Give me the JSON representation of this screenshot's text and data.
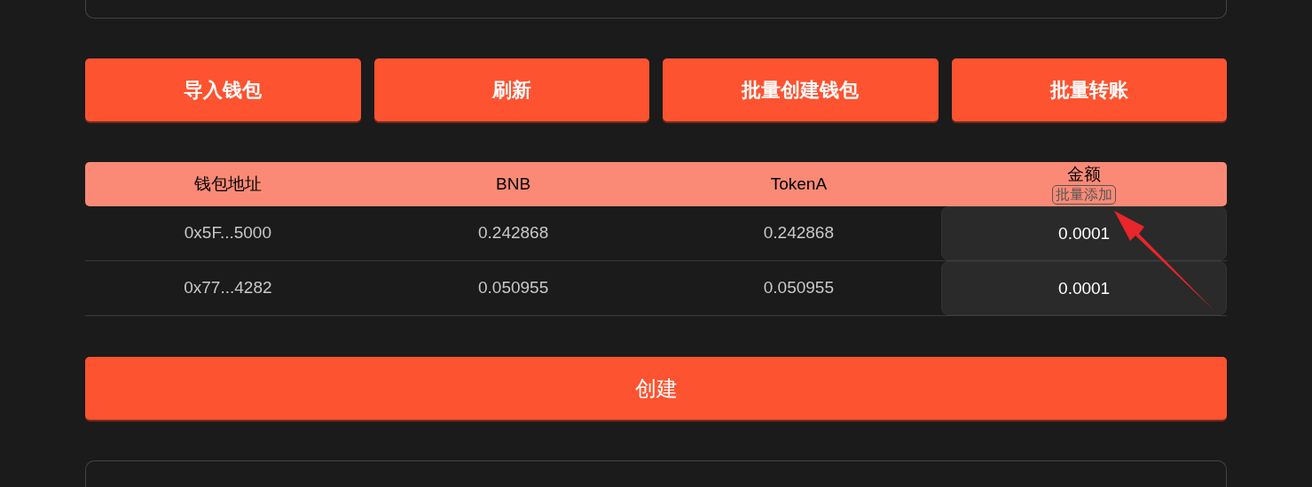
{
  "action_buttons": [
    {
      "label": "导入钱包"
    },
    {
      "label": "刷新"
    },
    {
      "label": "批量创建钱包"
    },
    {
      "label": "批量转账"
    }
  ],
  "table": {
    "columns": [
      {
        "label": "钱包地址"
      },
      {
        "label": "BNB"
      },
      {
        "label": "TokenA"
      },
      {
        "label": "金额",
        "action": "批量添加"
      }
    ],
    "rows": [
      {
        "address": "0x5F...5000",
        "bnb": "0.242868",
        "token_a": "0.242868",
        "amount": "0.0001"
      },
      {
        "address": "0x77...4282",
        "bnb": "0.050955",
        "token_a": "0.050955",
        "amount": "0.0001"
      }
    ]
  },
  "create_button": {
    "label": "创建"
  }
}
